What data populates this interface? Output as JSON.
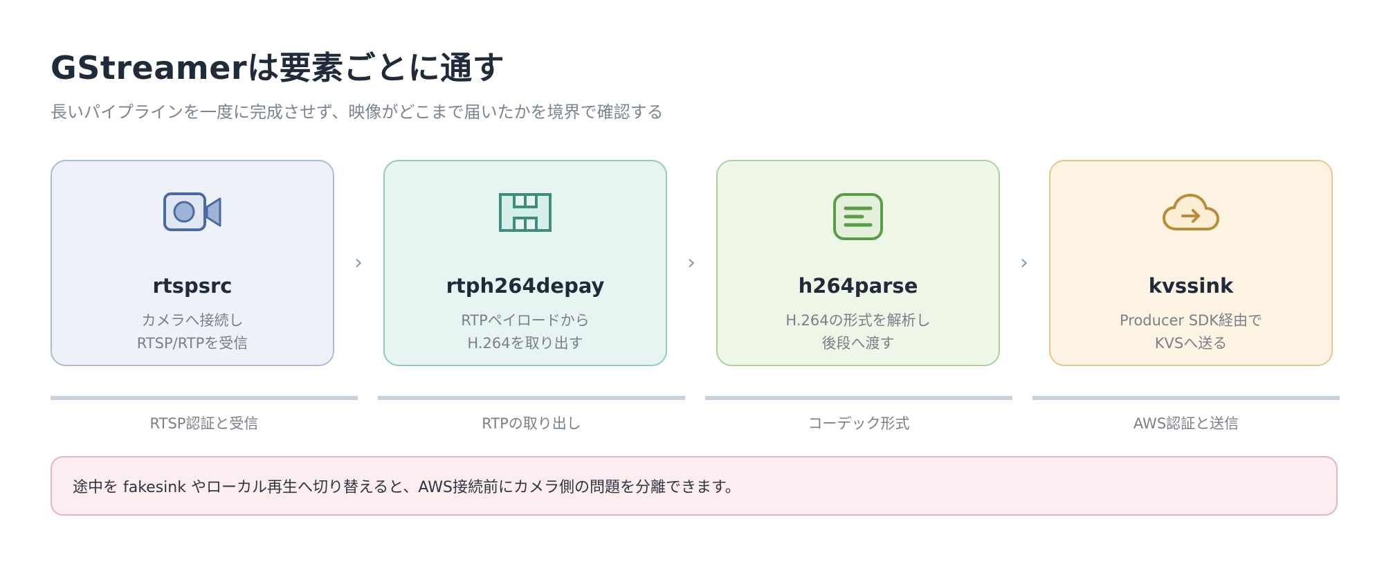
{
  "header": {
    "title": "GStreamerは要素ごとに通す",
    "subtitle": "長いパイプラインを一度に完成させず、映像がどこまで届いたかを境界で確認する"
  },
  "colors": {
    "card_1_accent": "#4a6aa5",
    "card_2_accent": "#3c8f7f",
    "card_3_accent": "#5a9d48",
    "card_4_accent": "#b98d35"
  },
  "pipeline": {
    "elements": [
      {
        "name": "rtspsrc",
        "desc_line1": "カメラへ接続し",
        "desc_line2": "RTSP/RTPを受信",
        "icon": "camera-icon"
      },
      {
        "name": "rtph264depay",
        "desc_line1": "RTPペイロードから",
        "desc_line2": "H.264を取り出す",
        "icon": "h-letter-icon"
      },
      {
        "name": "h264parse",
        "desc_line1": "H.264の形式を解析し",
        "desc_line2": "後段へ渡す",
        "icon": "document-lines-icon"
      },
      {
        "name": "kvssink",
        "desc_line1": "Producer SDK経由で",
        "desc_line2": "KVSへ送る",
        "icon": "cloud-upload-icon"
      }
    ],
    "arrow_glyph": "›"
  },
  "boundaries": [
    {
      "label": "RTSP認証と受信"
    },
    {
      "label": "RTPの取り出し"
    },
    {
      "label": "コーデック形式"
    },
    {
      "label": "AWS認証と送信"
    }
  ],
  "note": {
    "text": "途中を fakesink やローカル再生へ切り替えると、AWS接続前にカメラ側の問題を分離できます。"
  }
}
